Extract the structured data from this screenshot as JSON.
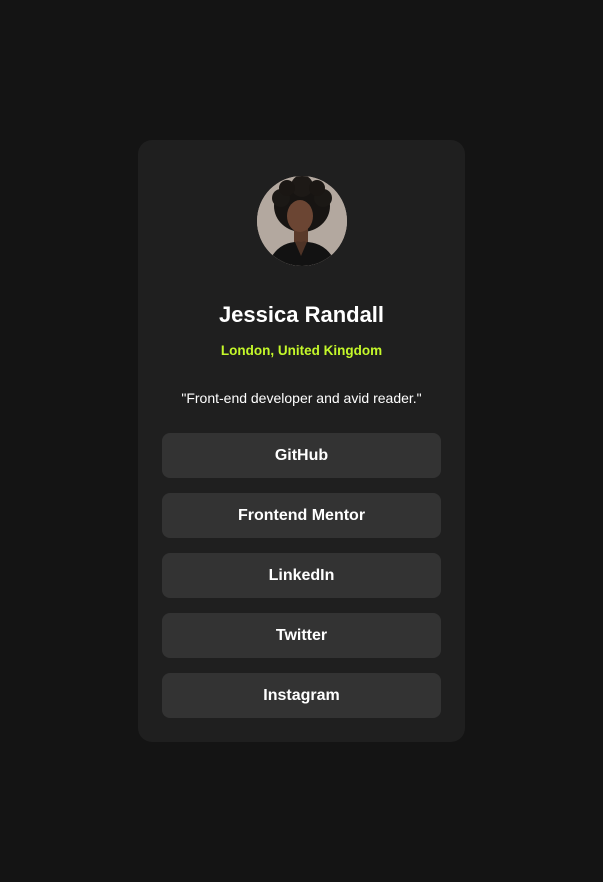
{
  "profile": {
    "name": "Jessica Randall",
    "location": "London, United Kingdom",
    "bio": "\"Front-end developer and avid reader.\"",
    "avatar_icon": "profile-photo"
  },
  "links": [
    {
      "label": "GitHub"
    },
    {
      "label": "Frontend Mentor"
    },
    {
      "label": "LinkedIn"
    },
    {
      "label": "Twitter"
    },
    {
      "label": "Instagram"
    }
  ],
  "colors": {
    "page_bg": "#141414",
    "card_bg": "#1f1f1f",
    "button_bg": "#333333",
    "accent": "#c4f82a",
    "text": "#ffffff"
  }
}
